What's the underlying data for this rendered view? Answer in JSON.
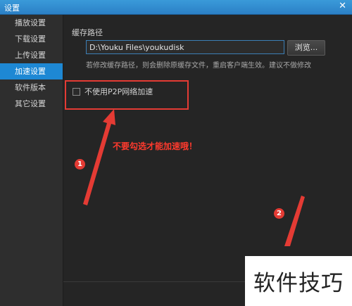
{
  "window": {
    "title": "设置",
    "close_glyph": "✕"
  },
  "sidebar": {
    "items": [
      {
        "label": "播放设置",
        "active": false
      },
      {
        "label": "下载设置",
        "active": false
      },
      {
        "label": "上传设置",
        "active": false
      },
      {
        "label": "加速设置",
        "active": true
      },
      {
        "label": "软件版本",
        "active": false
      },
      {
        "label": "其它设置",
        "active": false
      }
    ]
  },
  "main": {
    "cache_path_label": "缓存路径",
    "cache_path_value": "D:\\Youku Files\\youkudisk",
    "browse_label": "浏览...",
    "hint": "若修改缓存路径，则会删除原缓存文件，重启客户端生效。建议不做修改",
    "p2p_checkbox_label": "不使用P2P网络加速",
    "p2p_checkbox_checked": false
  },
  "annotations": {
    "note": "不要勾选才能加速哦！",
    "badge1": "1",
    "badge2": "2",
    "color": "#e43b34"
  },
  "watermark": "软件技巧"
}
